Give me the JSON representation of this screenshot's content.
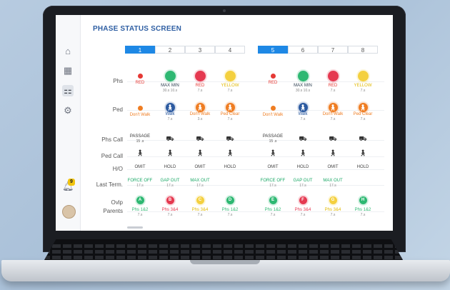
{
  "screen_title": "PHASE STATUS SCREEN",
  "columns": [
    "1",
    "2",
    "3",
    "4",
    "5",
    "6",
    "7",
    "8"
  ],
  "selected_columns": [
    0,
    4
  ],
  "row_labels": {
    "phs": "Phs",
    "ped": "Ped",
    "phs_call": "Phs Call",
    "ped_call": "Ped Call",
    "ho": "H/O",
    "last_term": "Last Term.",
    "ovlp": "Ovlp",
    "parents": "Parents"
  },
  "phs": [
    {
      "style": "small",
      "color": "#e53935",
      "label": "RED",
      "label_color": "#e53935",
      "sub": ""
    },
    {
      "style": "big",
      "color": "#2eb872",
      "label": "MAX MIN",
      "label_color": "#2c3e50",
      "sub": "30.s 10.s"
    },
    {
      "style": "big",
      "color": "#e53950",
      "label": "RED",
      "label_color": "#e53935",
      "sub": "7.s"
    },
    {
      "style": "big",
      "color": "#f4d03f",
      "label": "YELLOW",
      "label_color": "#e0b800",
      "sub": "7.s"
    },
    {
      "style": "small",
      "color": "#e53935",
      "label": "RED",
      "label_color": "#e53935",
      "sub": ""
    },
    {
      "style": "big",
      "color": "#2eb872",
      "label": "MAX MIN",
      "label_color": "#2c3e50",
      "sub": "30.s 10.s"
    },
    {
      "style": "big",
      "color": "#e53950",
      "label": "RED",
      "label_color": "#e53935",
      "sub": "7.s"
    },
    {
      "style": "big",
      "color": "#f4d03f",
      "label": "YELLOW",
      "label_color": "#e0b800",
      "sub": "7.s"
    }
  ],
  "ped": [
    {
      "style": "small",
      "color": "#ef7d22",
      "label": "Don't Walk",
      "label_color": "#ef7d22",
      "sub": ""
    },
    {
      "style": "big",
      "color": "#2c5aa0",
      "label": "Walk",
      "label_color": "#2c5aa0",
      "sub": "7.s"
    },
    {
      "style": "big",
      "color": "#ef7d22",
      "label": "Don't Walk",
      "label_color": "#ef7d22",
      "sub": "3.s"
    },
    {
      "style": "big",
      "color": "#ef7d22",
      "label": "Ped Clear",
      "label_color": "#ef7d22",
      "sub": "7.s"
    },
    {
      "style": "small",
      "color": "#ef7d22",
      "label": "Don't Walk",
      "label_color": "#ef7d22",
      "sub": ""
    },
    {
      "style": "big",
      "color": "#2c5aa0",
      "label": "Walk",
      "label_color": "#2c5aa0",
      "sub": "7.s"
    },
    {
      "style": "big",
      "color": "#ef7d22",
      "label": "Don't Walk",
      "label_color": "#ef7d22",
      "sub": "7.s"
    },
    {
      "style": "big",
      "color": "#ef7d22",
      "label": "Ped Clear",
      "label_color": "#ef7d22",
      "sub": "7.s"
    }
  ],
  "phs_call": [
    {
      "text": "PASSAGE",
      "sub": "15 .s"
    },
    {
      "icon": "car"
    },
    {
      "icon": "car"
    },
    {
      "icon": "car"
    },
    {
      "text": "PASSAGE",
      "sub": "15 .s"
    },
    {
      "icon": "car"
    },
    {
      "icon": "car"
    },
    {
      "icon": "car"
    }
  ],
  "ped_call_icon": "pedestrian",
  "ho": [
    "OMIT",
    "HOLD",
    "OMIT",
    "HOLD",
    "OMIT",
    "HOLD",
    "OMIT",
    "HOLD"
  ],
  "last_term": [
    {
      "text": "FORCE OFF",
      "sub": "17.s"
    },
    {
      "text": "GAP OUT",
      "sub": "17.s"
    },
    {
      "text": "MAX OUT",
      "sub": "17.s"
    },
    {
      "text": "",
      "sub": ""
    },
    {
      "text": "FORCE OFF",
      "sub": "17.s"
    },
    {
      "text": "GAP OUT",
      "sub": "17.s"
    },
    {
      "text": "MAX OUT",
      "sub": "17.s"
    },
    {
      "text": "",
      "sub": ""
    }
  ],
  "ovlp": [
    {
      "letter": "A",
      "color": "#2eb872",
      "badge": "RTS"
    },
    {
      "letter": "B",
      "color": "#e53950",
      "badge": "TL"
    },
    {
      "letter": "C",
      "color": "#f4d03f",
      "badge": "TL"
    },
    {
      "letter": "D",
      "color": "#2eb872",
      "badge": ""
    },
    {
      "letter": "E",
      "color": "#2eb872",
      "badge": "RTS"
    },
    {
      "letter": "F",
      "color": "#e53950",
      "badge": "TL"
    },
    {
      "letter": "G",
      "color": "#f4d03f",
      "badge": "TL"
    },
    {
      "letter": "H",
      "color": "#2eb872",
      "badge": ""
    }
  ],
  "parents": [
    {
      "text": "Phs 1&2",
      "sub": "7.s",
      "color": "#2eb872"
    },
    {
      "text": "Phs 3&4",
      "sub": "7.s",
      "color": "#e53950"
    },
    {
      "text": "Phs 3&4",
      "sub": "7.s",
      "color": "#e0b800"
    },
    {
      "text": "Phs 1&2",
      "sub": "7.s",
      "color": "#2eb872"
    },
    {
      "text": "Phs 1&2",
      "sub": "7.s",
      "color": "#2eb872"
    },
    {
      "text": "Phs 3&4",
      "sub": "7.s",
      "color": "#e53950"
    },
    {
      "text": "Phs 3&4",
      "sub": "7.s",
      "color": "#e0b800"
    },
    {
      "text": "Phs 1&2",
      "sub": "7.s",
      "color": "#2eb872"
    }
  ],
  "notification_count": "9",
  "sidebar_icons": [
    "home-icon",
    "grid-icon",
    "traffic-light-icon",
    "settings-icon"
  ]
}
